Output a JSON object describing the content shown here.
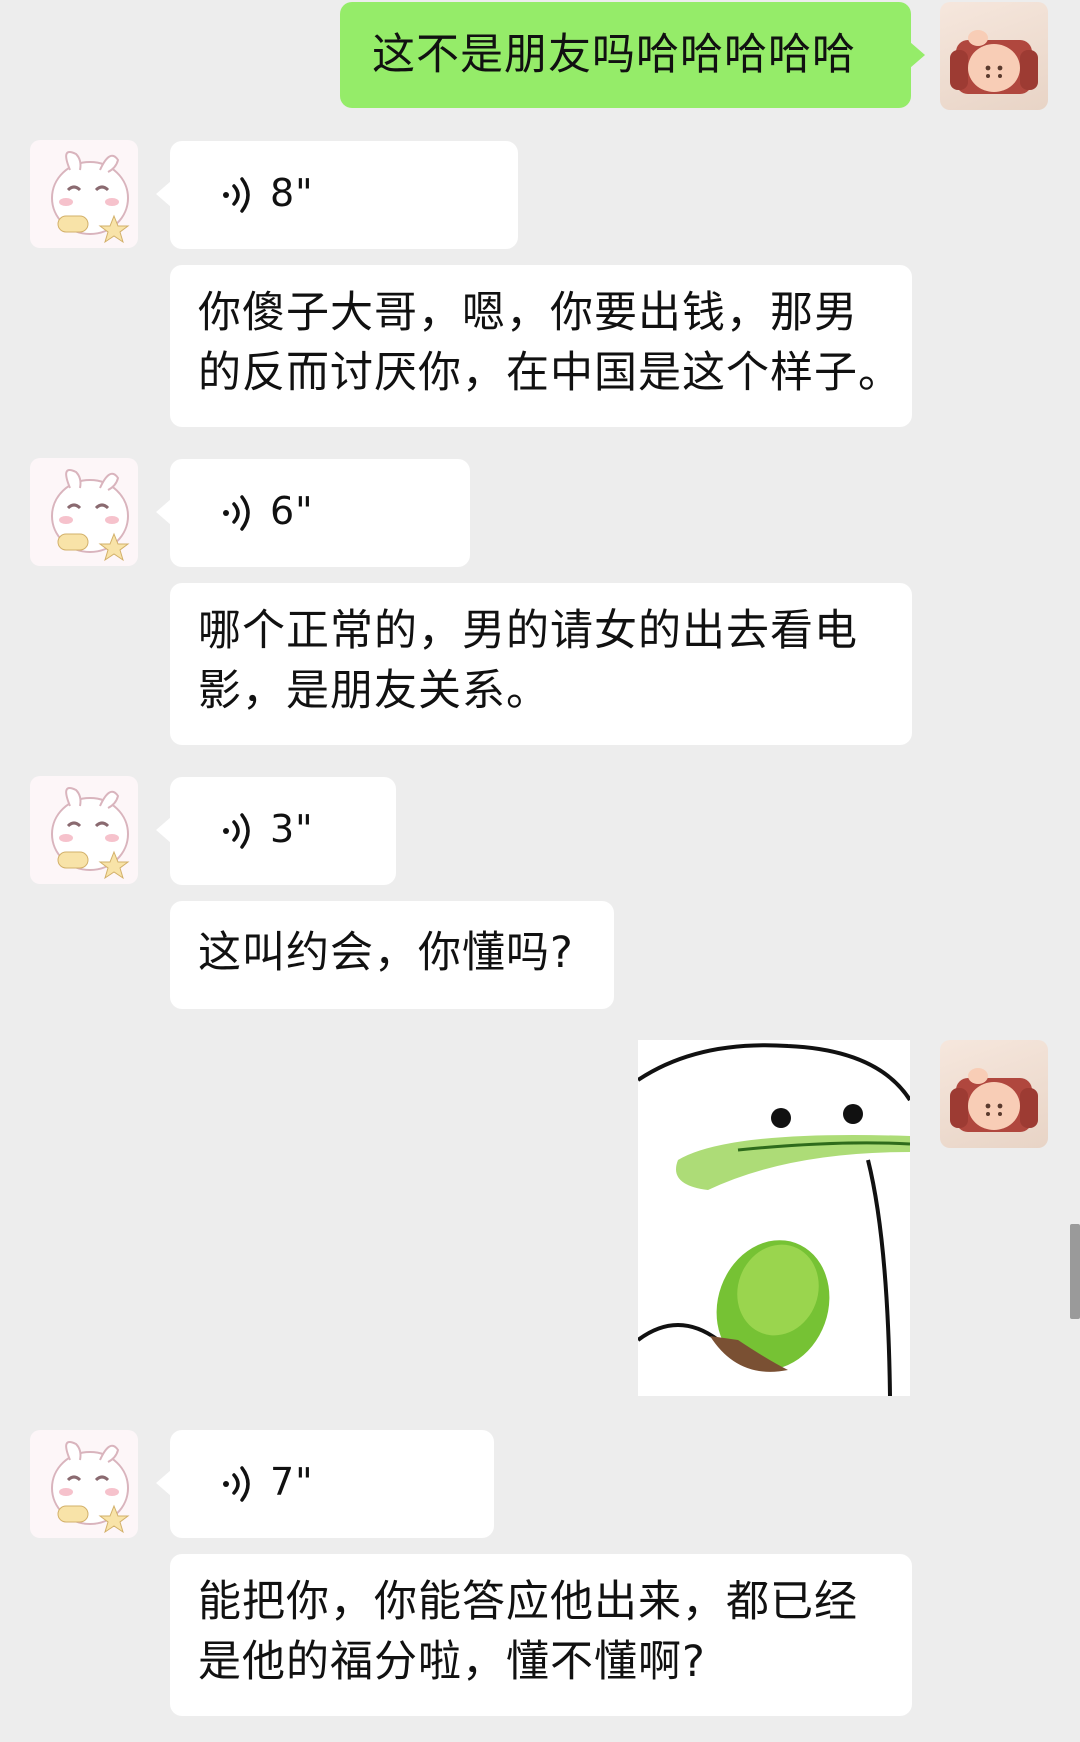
{
  "messages": [
    {
      "side": "right",
      "type": "text",
      "text": "这不是朋友吗哈哈哈哈哈"
    },
    {
      "side": "left",
      "type": "voice",
      "duration": "8\""
    },
    {
      "side": "left",
      "type": "text",
      "lines": [
        "你傻子大哥，嗯，你要出钱，那男",
        "的反而讨厌你，在中国是这个样子。"
      ]
    },
    {
      "side": "left",
      "type": "voice",
      "duration": "6\""
    },
    {
      "side": "left",
      "type": "text",
      "lines": [
        "哪个正常的，男的请女的出去看电",
        "影，是朋友关系。"
      ]
    },
    {
      "side": "left",
      "type": "voice",
      "duration": "3\""
    },
    {
      "side": "left",
      "type": "text",
      "text": "这叫约会，你懂吗?"
    },
    {
      "side": "right",
      "type": "sticker",
      "icon": "kiwi-face-sticker"
    },
    {
      "side": "left",
      "type": "voice",
      "duration": "7\""
    },
    {
      "side": "left",
      "type": "text",
      "lines": [
        "能把你，你能答应他出来，都已经",
        "是他的福分啦，懂不懂啊?"
      ]
    }
  ],
  "colors": {
    "background": "#ededed",
    "self_bubble": "#95ec69",
    "other_bubble": "#ffffff"
  }
}
